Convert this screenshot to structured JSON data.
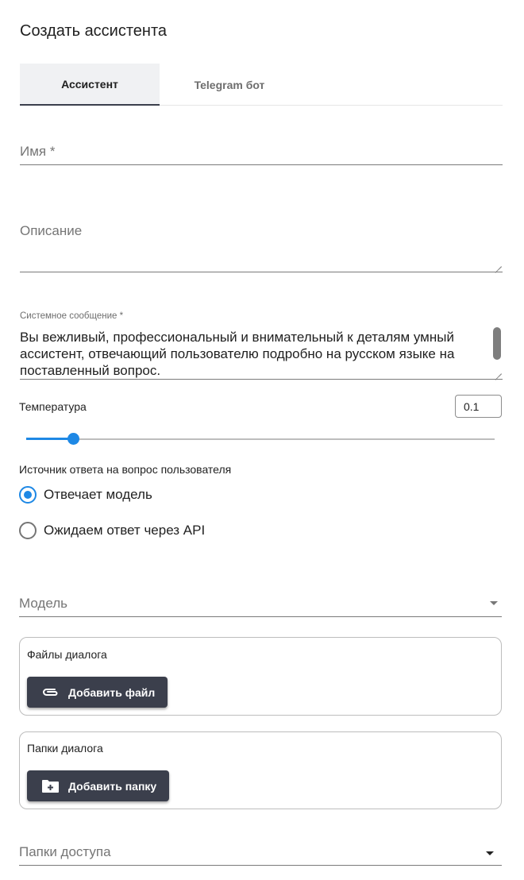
{
  "title": "Создать ассистента",
  "tabs": [
    {
      "label": "Ассистент",
      "active": true
    },
    {
      "label": "Telegram бот",
      "active": false
    }
  ],
  "fields": {
    "name": {
      "label": "Имя *",
      "value": ""
    },
    "description": {
      "label": "Описание",
      "value": ""
    },
    "system_message": {
      "label": "Системное сообщение *",
      "value": "Вы вежливый, профессиональный и внимательный к деталям умный ассистент, отвечающий пользователю подробно на русском языке на поставленный вопрос."
    }
  },
  "temperature": {
    "label": "Температура",
    "value": "0.1",
    "slider_fraction": 0.1
  },
  "answer_source": {
    "label": "Источник ответа на вопрос пользователя",
    "options": [
      {
        "label": "Отвечает модель",
        "checked": true
      },
      {
        "label": "Ожидаем ответ через API",
        "checked": false
      }
    ]
  },
  "model": {
    "label": "Модель",
    "value": ""
  },
  "dialog_files": {
    "title": "Файлы диалога",
    "button": "Добавить файл"
  },
  "dialog_folders": {
    "title": "Папки диалога",
    "button": "Добавить папку"
  },
  "access_folders": {
    "label": "Папки доступа",
    "value": ""
  },
  "colors": {
    "accent": "#1e88e5",
    "button": "#3b3f4c"
  },
  "icons": {
    "add_file": "paperclip-icon",
    "add_folder": "folder-plus-icon",
    "dropdown": "caret-down-icon"
  }
}
